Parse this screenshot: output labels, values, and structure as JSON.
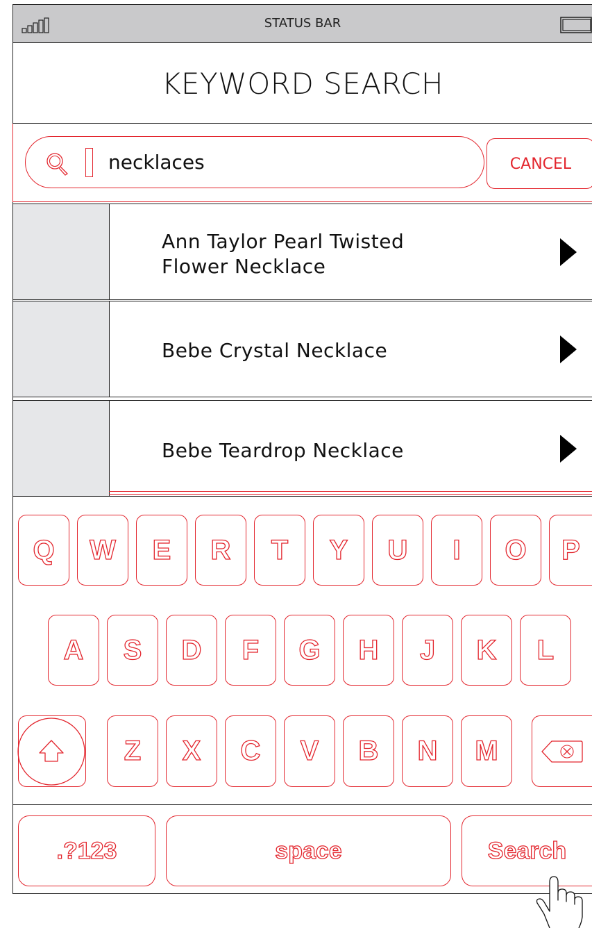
{
  "status_bar": {
    "label": "STATUS BAR"
  },
  "header": {
    "title": "KEYWORD SEARCH"
  },
  "search": {
    "value": "necklaces",
    "cancel_label": "CANCEL"
  },
  "results": [
    {
      "line1": "Ann Taylor Pearl Twisted",
      "line2": "Flower Necklace"
    },
    {
      "line1": "Bebe Crystal Necklace"
    },
    {
      "line1": "Bebe Teardrop Necklace"
    }
  ],
  "keyboard": {
    "row1": [
      "Q",
      "W",
      "E",
      "R",
      "T",
      "Y",
      "U",
      "I",
      "O",
      "P"
    ],
    "row2": [
      "A",
      "S",
      "D",
      "F",
      "G",
      "H",
      "J",
      "K",
      "L"
    ],
    "row3": [
      "Z",
      "X",
      "C",
      "V",
      "B",
      "N",
      "M"
    ],
    "shift_icon": "shift-arrow-icon",
    "backspace_icon": "backspace-icon",
    "numbers_label": ".?123",
    "space_label": "space",
    "search_label": "Search"
  },
  "colors": {
    "accent": "#e3262e",
    "status_bg": "#c9c9cb",
    "thumb_bg": "#e6e7e9"
  }
}
